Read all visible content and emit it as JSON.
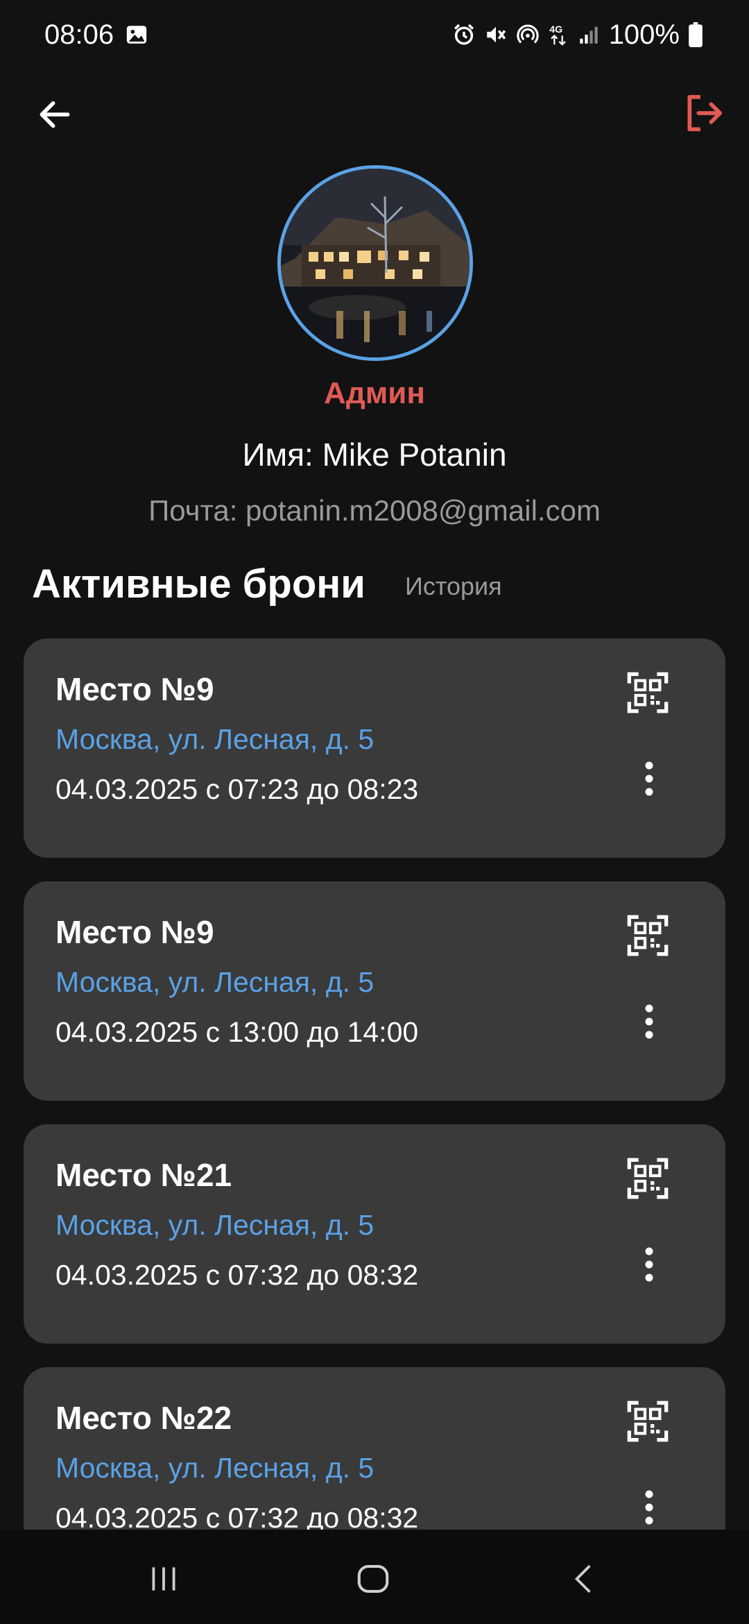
{
  "status_bar": {
    "time": "08:06",
    "battery": "100%",
    "icons": [
      "gallery-icon",
      "alarm-icon",
      "mute-icon",
      "hotspot-icon",
      "4g-icon",
      "signal-icon",
      "battery-icon"
    ]
  },
  "header": {
    "back_icon": "arrow-left-icon",
    "logout_icon": "logout-icon"
  },
  "profile": {
    "avatar": "building-photo",
    "role": "Админ",
    "name": "Имя: Mike Potanin",
    "email": "Почта: potanin.m2008@gmail.com"
  },
  "bookings": {
    "title": "Активные брони",
    "history_label": "История",
    "items": [
      {
        "place": "Место №9",
        "address": "Москва, ул. Лесная, д. 5",
        "time": "04.03.2025 с 07:23 до 08:23"
      },
      {
        "place": "Место №9",
        "address": "Москва, ул. Лесная, д. 5",
        "time": "04.03.2025 с 13:00 до 14:00"
      },
      {
        "place": "Место №21",
        "address": "Москва, ул. Лесная, д. 5",
        "time": "04.03.2025 с 07:32 до 08:32"
      },
      {
        "place": "Место №22",
        "address": "Москва, ул. Лесная, д. 5",
        "time": "04.03.2025 с 07:32 до 08:32"
      }
    ]
  },
  "nav_bar": {
    "icons": [
      "recent-apps-icon",
      "home-icon",
      "back-icon"
    ]
  },
  "colors": {
    "background": "#121212",
    "card": "#3a3a3a",
    "accent_blue": "#5aa2e6",
    "accent_red": "#e05a55",
    "muted_text": "#9a9a9a"
  }
}
